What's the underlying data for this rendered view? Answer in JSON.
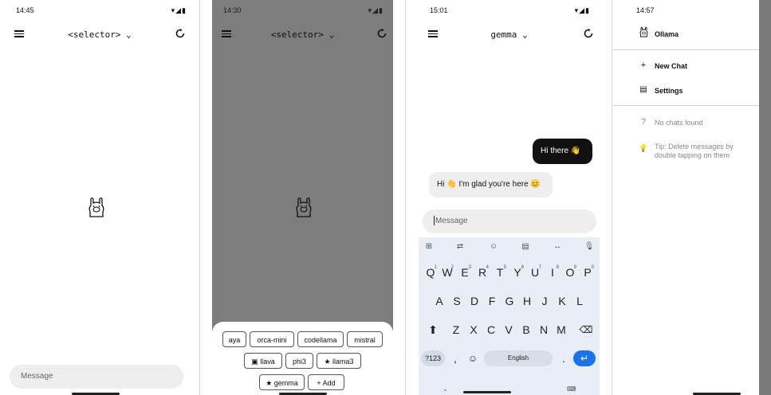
{
  "screen1": {
    "time": "14:45",
    "status_icons": "▾◢▮",
    "title": "<selector>",
    "message_placeholder": "Message"
  },
  "screen2": {
    "time": "14:30",
    "status_icons": "▾◢▮",
    "title": "<selector>",
    "chips_row1": [
      "aya",
      "orca-mini",
      "codellama",
      "mistral"
    ],
    "chips_row2": [
      "llava",
      "phi3",
      "llama3"
    ],
    "chips_row3": [
      "gemma",
      "Add"
    ],
    "star": "★",
    "plus": "+",
    "image": "▣"
  },
  "screen3": {
    "time": "15:01",
    "status_icons": "▾◢▮",
    "title": "gemma",
    "user_message": "Hi there 👋",
    "bot_message": "Hi 👋 I'm glad you're here 😊",
    "message_placeholder": "Message",
    "keyboard": {
      "row1": [
        "Q",
        "W",
        "E",
        "R",
        "T",
        "Y",
        "U",
        "I",
        "O",
        "P"
      ],
      "row1_hints": [
        "1",
        "2",
        "3",
        "4",
        "5",
        "6",
        "7",
        "8",
        "9",
        "0"
      ],
      "row2": [
        "A",
        "S",
        "D",
        "F",
        "G",
        "H",
        "J",
        "K",
        "L"
      ],
      "row3": [
        "Z",
        "X",
        "C",
        "V",
        "B",
        "N",
        "M"
      ],
      "sym_key": "?123",
      "comma": ",",
      "period": ".",
      "space": "English",
      "emoji": "☺",
      "shift": "⬆",
      "backspace": "⌫",
      "enter": "↵",
      "suggestion_icons": [
        "⊞",
        "⇄",
        "☺",
        "▤",
        "↔",
        "🎙"
      ]
    }
  },
  "screen4": {
    "time": "14:57",
    "app_name": "Ollama",
    "new_chat": "New Chat",
    "settings": "Settings",
    "no_chats": "No chats found",
    "tip": "Tip: Delete messages by double tapping on them",
    "plus_icon": "+",
    "question_icon": "?",
    "bulb_icon": "💡"
  }
}
